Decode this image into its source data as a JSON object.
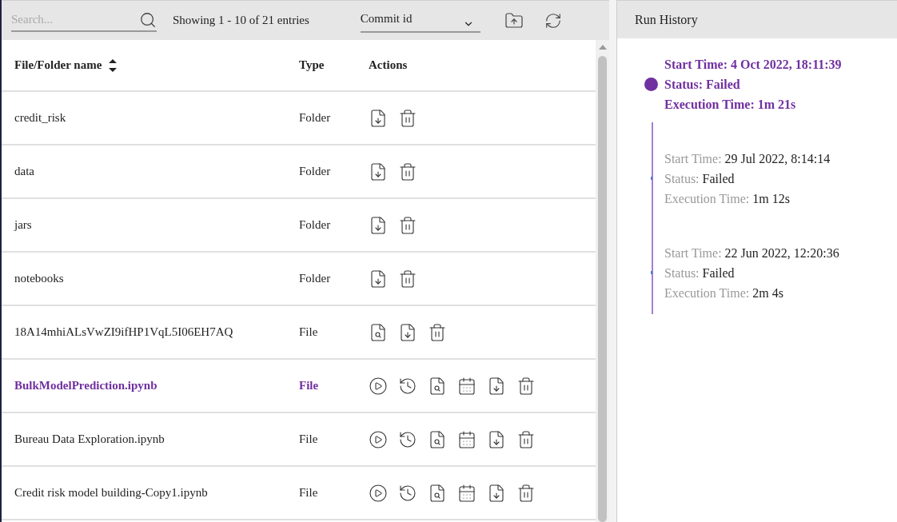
{
  "toolbar": {
    "search": {
      "placeholder": "Search..."
    },
    "entries": "Showing 1 - 10 of 21 entries",
    "commit": {
      "value": "Commit id"
    }
  },
  "table": {
    "columns": [
      "File/Folder name",
      "Type",
      "Actions"
    ],
    "rows": [
      {
        "name": "credit_risk",
        "type": "Folder",
        "selected": false,
        "actions": [
          {
            "kind": "download"
          },
          {
            "kind": "delete"
          }
        ]
      },
      {
        "name": "data",
        "type": "Folder",
        "selected": false,
        "actions": [
          {
            "kind": "download"
          },
          {
            "kind": "delete"
          }
        ]
      },
      {
        "name": "jars",
        "type": "Folder",
        "selected": false,
        "actions": [
          {
            "kind": "download"
          },
          {
            "kind": "delete"
          }
        ]
      },
      {
        "name": "notebooks",
        "type": "Folder",
        "selected": false,
        "actions": [
          {
            "kind": "download"
          },
          {
            "kind": "delete"
          }
        ]
      },
      {
        "name": "18A14mhiALsVwZI9ifHP1VqL5I06EH7AQ",
        "type": "File",
        "selected": false,
        "actions": [
          {
            "kind": "preview"
          },
          {
            "kind": "download"
          },
          {
            "kind": "delete"
          }
        ]
      },
      {
        "name": "BulkModelPrediction.ipynb",
        "type": "File",
        "selected": true,
        "actions": [
          {
            "kind": "run"
          },
          {
            "kind": "history"
          },
          {
            "kind": "preview"
          },
          {
            "kind": "schedule"
          },
          {
            "kind": "download"
          },
          {
            "kind": "delete"
          }
        ]
      },
      {
        "name": "Bureau Data Exploration.ipynb",
        "type": "File",
        "selected": false,
        "actions": [
          {
            "kind": "run"
          },
          {
            "kind": "history"
          },
          {
            "kind": "preview"
          },
          {
            "kind": "schedule"
          },
          {
            "kind": "download"
          },
          {
            "kind": "delete"
          }
        ]
      },
      {
        "name": "Credit risk model building-Copy1.ipynb",
        "type": "File",
        "selected": false,
        "actions": [
          {
            "kind": "run"
          },
          {
            "kind": "history"
          },
          {
            "kind": "preview"
          },
          {
            "kind": "schedule"
          },
          {
            "kind": "download"
          },
          {
            "kind": "delete"
          }
        ]
      }
    ]
  },
  "run_history": {
    "title": "Run History",
    "runs": [
      {
        "selected": true,
        "start_label": "Start Time:",
        "start": "4 Oct 2022, 18:11:39",
        "status_label": "Status:",
        "status": "Failed",
        "exec_label": "Execution Time:",
        "exec": "1m 21s"
      },
      {
        "selected": false,
        "start_label": "Start Time:",
        "start": "29 Jul 2022, 8:14:14",
        "status_label": "Status:",
        "status": "Failed",
        "exec_label": "Execution Time:",
        "exec": "1m 12s"
      },
      {
        "selected": false,
        "start_label": "Start Time:",
        "start": "22 Jun 2022, 12:20:36",
        "status_label": "Status:",
        "status": "Failed",
        "exec_label": "Execution Time:",
        "exec": "2m 4s"
      }
    ]
  }
}
